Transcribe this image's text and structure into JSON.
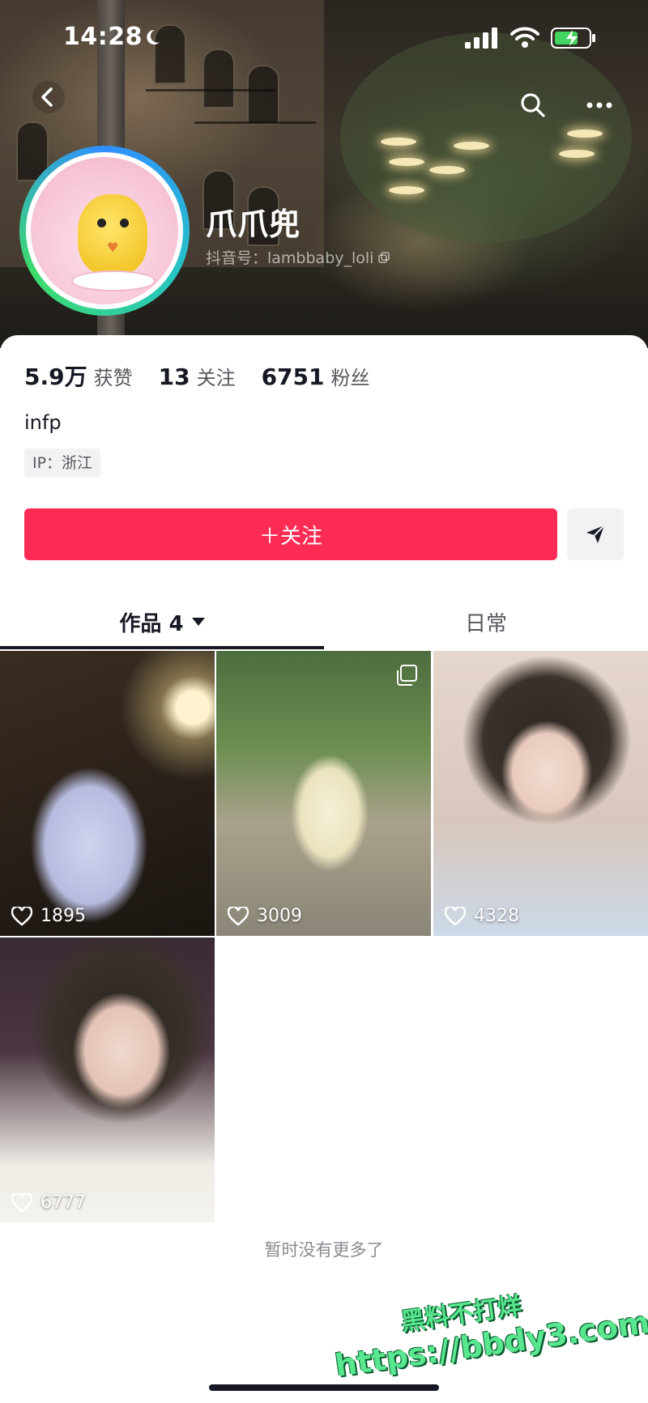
{
  "status_bar": {
    "time": "14:28",
    "icons": [
      "moon-icon",
      "signal-icon",
      "wifi-icon",
      "battery-charging-icon"
    ]
  },
  "header": {
    "nav_icons": [
      "back-icon",
      "search-icon",
      "more-icon"
    ],
    "nickname": "爪爪兜",
    "douyin_id": "抖音号：lambbaby_loli",
    "avatar_ring_colors": [
      "#2f8fff",
      "#3ddc6a"
    ]
  },
  "profile": {
    "stats": [
      {
        "value": "5.9万",
        "label": "获赞"
      },
      {
        "value": "13",
        "label": "关注"
      },
      {
        "value": "6751",
        "label": "粉丝"
      }
    ],
    "bio": "infp",
    "ip": "IP：浙江"
  },
  "actions": {
    "follow_label": "＋关注",
    "follow_color": "#fe2c55",
    "message_icon": "send-icon"
  },
  "tabs": [
    {
      "label": "作品 4",
      "active": true
    },
    {
      "label": "日常",
      "active": false
    }
  ],
  "videos": [
    {
      "likes": "1895"
    },
    {
      "likes": "3009",
      "multi": true
    },
    {
      "likes": "4328"
    },
    {
      "likes": "6777"
    }
  ],
  "end_text": "暂时没有更多了",
  "watermark": {
    "line1": "黑料不打烊",
    "line2": "https://bbdy3.com",
    "color": "#58e68f"
  }
}
